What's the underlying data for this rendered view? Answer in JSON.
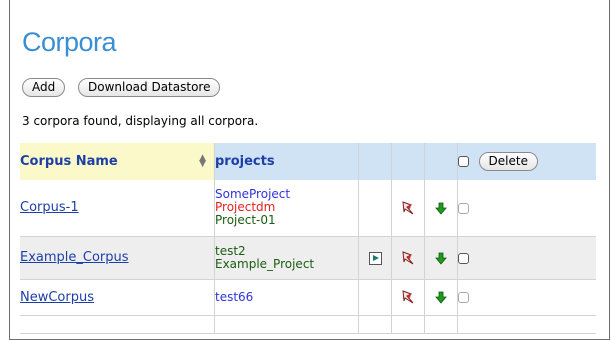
{
  "page": {
    "title": "Corpora",
    "add_label": "Add",
    "download_label": "Download Datastore",
    "summary": "3 corpora found, displaying all corpora."
  },
  "table": {
    "headers": {
      "corpus_name": "Corpus Name",
      "projects": "projects",
      "delete_label": "Delete"
    },
    "rows": [
      {
        "name": "Corpus-1",
        "projects": [
          "SomeProject",
          "Projectdm",
          "Project-01"
        ],
        "has_play": false
      },
      {
        "name": "Example_Corpus",
        "projects": [
          "test2",
          "Example_Project"
        ],
        "has_play": true
      },
      {
        "name": "NewCorpus",
        "projects": [
          "test66"
        ],
        "has_play": false
      }
    ]
  },
  "colors": {
    "title": "#3b8ed2",
    "header_bg": "#cfe3f5",
    "sorted_header_bg": "#fbf9c9",
    "link": "#1d3fa8",
    "project_blue": "#2f33dd",
    "project_red": "#e62020",
    "project_green": "#1b5c12",
    "arrow_green": "#1e9b1e"
  },
  "icons": {
    "sort": "sort-arrows-icon",
    "play": "play-icon",
    "edit": "edit-pin-icon",
    "download": "green-down-arrow-icon",
    "checkbox": "checkbox"
  }
}
